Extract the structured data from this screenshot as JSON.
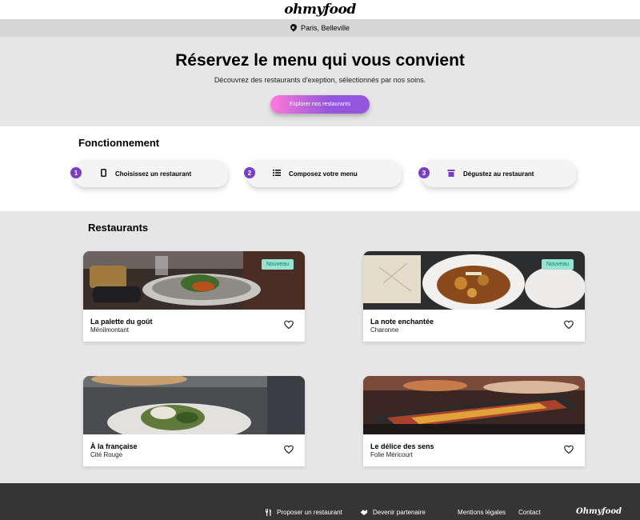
{
  "header": {
    "logo": "ohmyfood"
  },
  "location": {
    "text": "Paris, Belleville",
    "icon": "map-pin-icon"
  },
  "hero": {
    "title": "Réservez le menu qui vous convient",
    "subtitle": "Découvrez des restaurants d'exeption, sélectionnés par nos soins.",
    "cta_label": "Explorer nos restaurants"
  },
  "fonctionnement": {
    "title": "Fonctionnement",
    "steps": [
      {
        "num": "1",
        "label": "Choisissez un restaurant",
        "icon": "mobile-phone-icon"
      },
      {
        "num": "2",
        "label": "Composez votre menu",
        "icon": "list-icon"
      },
      {
        "num": "3",
        "label": "Dégustez au restaurant",
        "icon": "restaurant-icon"
      }
    ]
  },
  "restaurants": {
    "title": "Restaurants",
    "items": [
      {
        "name": "La palette du goût",
        "area": "Ménilmontant",
        "badge": "Nouveau"
      },
      {
        "name": "La note enchantée",
        "area": "Charonne",
        "badge": "Nouveau"
      },
      {
        "name": "À la française",
        "area": "Cité Rouge"
      },
      {
        "name": "Le délice des sens",
        "area": "Folie Méricourt"
      }
    ]
  },
  "footer": {
    "propose": "Proposer un restaurant",
    "partenaire": "Devenir partenaire",
    "mentions": "Mentions légales",
    "contact": "Contact",
    "logo": "Ohmyfood"
  },
  "colors": {
    "primary": "#9356dc",
    "secondary": "#ff79da",
    "badge": "#99e2d0",
    "footer": "#353535"
  }
}
